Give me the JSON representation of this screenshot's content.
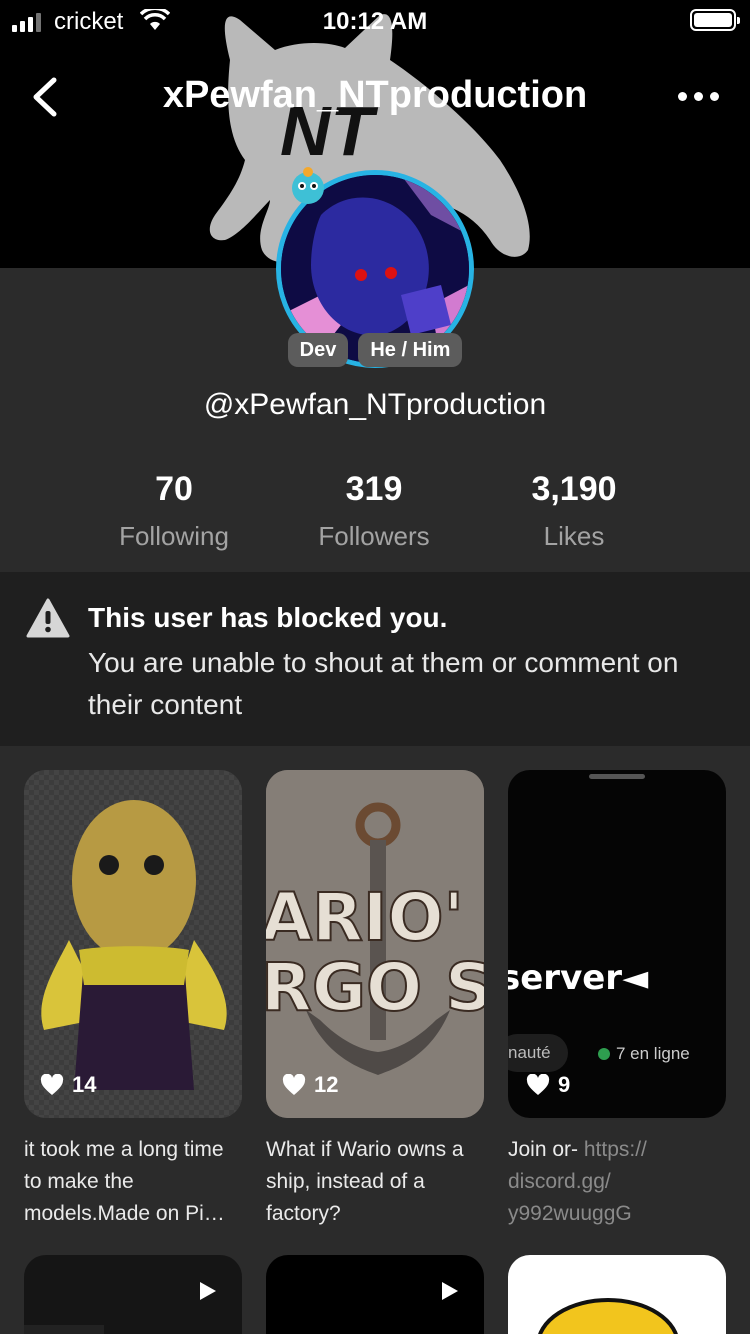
{
  "status": {
    "carrier": "cricket",
    "time": "10:12 AM"
  },
  "nav": {
    "title": "xPewfan_NTproduction"
  },
  "profile": {
    "tags": [
      "Dev",
      "He / Him"
    ],
    "handle": "@xPewfan_NTproduction",
    "stats": [
      {
        "value": "70",
        "label": "Following"
      },
      {
        "value": "319",
        "label": "Followers"
      },
      {
        "value": "3,190",
        "label": "Likes"
      }
    ]
  },
  "blocked": {
    "title": "This user has blocked you.",
    "message": "You are unable to shout at them or comment on their content"
  },
  "posts": [
    {
      "likes": "14",
      "caption": "it took me a long time to make the models.Made on Pi…"
    },
    {
      "likes": "12",
      "caption": "What if Wario owns a ship, instead of a factory?",
      "art_text_1": "ARIO'",
      "art_text_2": "RGO SH"
    },
    {
      "likes": "9",
      "caption_prefix": "Join or- ",
      "caption_link": "https:// discord.gg/ y992wuuggG",
      "art_text": "server",
      "pill_left": "nauté",
      "pill_right": "7 en ligne"
    }
  ],
  "colors": {
    "background": "#2b2b2b",
    "banner": "#000000",
    "avatar_ring": "#27b3e4",
    "blocked_panel": "#1f1f1f",
    "muted_text": "#a3a3a3",
    "online_dot": "#2e9e4f"
  }
}
